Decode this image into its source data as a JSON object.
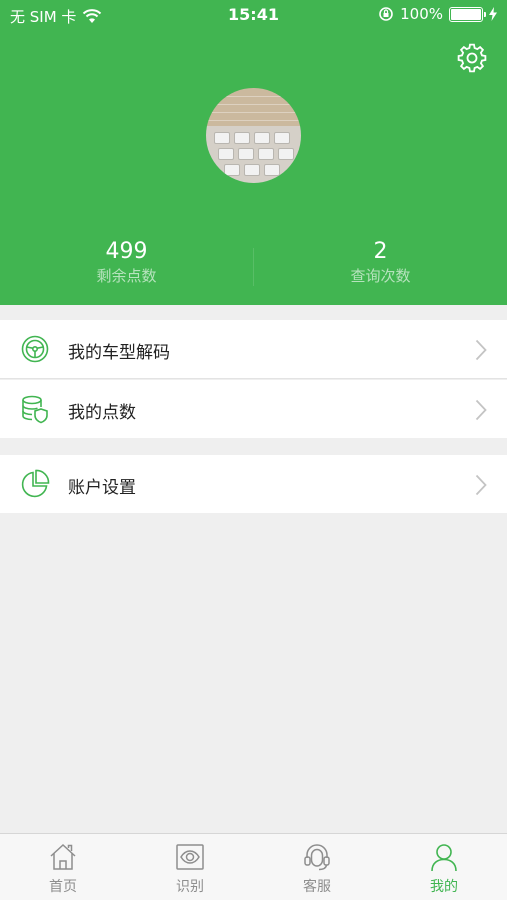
{
  "status_bar": {
    "carrier": "无 SIM 卡",
    "time": "15:41",
    "battery": "100%"
  },
  "profile": {
    "stats": [
      {
        "value": "499",
        "label": "剩余点数"
      },
      {
        "value": "2",
        "label": "查询次数"
      }
    ]
  },
  "menu": {
    "items": [
      {
        "label": "我的车型解码",
        "icon": "steering-wheel-icon"
      },
      {
        "label": "我的点数",
        "icon": "coins-shield-icon"
      },
      {
        "label": "账户设置",
        "icon": "pie-chart-icon"
      }
    ]
  },
  "tabbar": {
    "tabs": [
      {
        "label": "首页",
        "icon": "home-icon",
        "active": false
      },
      {
        "label": "识别",
        "icon": "eye-scan-icon",
        "active": false
      },
      {
        "label": "客服",
        "icon": "headset-icon",
        "active": false
      },
      {
        "label": "我的",
        "icon": "user-icon",
        "active": true
      }
    ]
  },
  "colors": {
    "brand": "#41b551",
    "background": "#efefef",
    "inactive_tab": "#8e8e8e"
  }
}
